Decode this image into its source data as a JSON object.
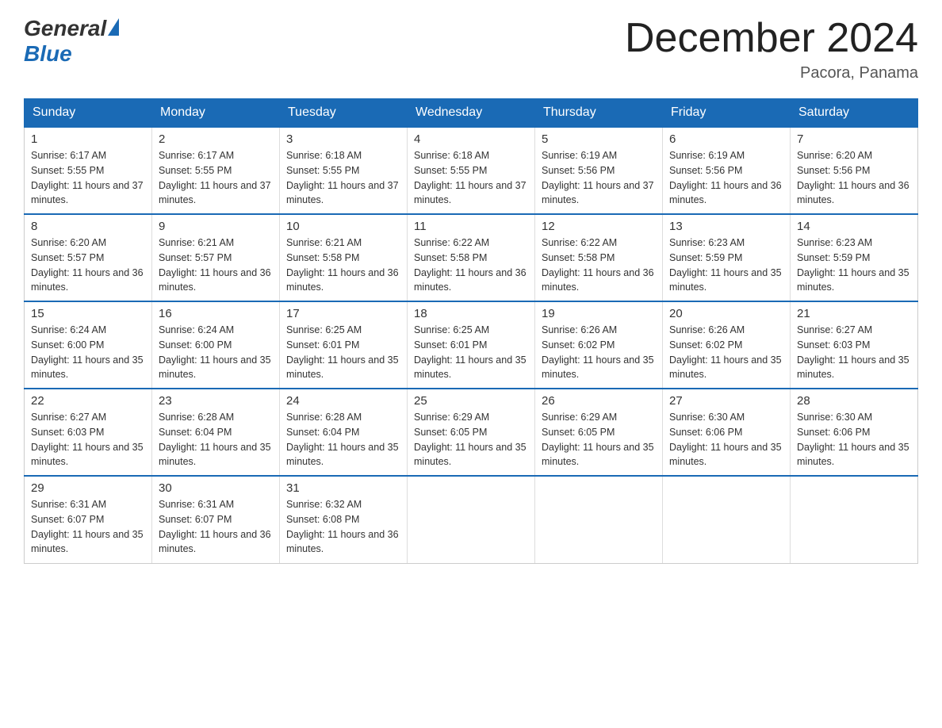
{
  "logo": {
    "text_general": "General",
    "text_blue": "Blue",
    "triangle_color": "#1a6ab5"
  },
  "header": {
    "month_year": "December 2024",
    "location": "Pacora, Panama"
  },
  "days_of_week": [
    "Sunday",
    "Monday",
    "Tuesday",
    "Wednesday",
    "Thursday",
    "Friday",
    "Saturday"
  ],
  "weeks": [
    [
      {
        "day": "1",
        "sunrise": "6:17 AM",
        "sunset": "5:55 PM",
        "daylight": "11 hours and 37 minutes."
      },
      {
        "day": "2",
        "sunrise": "6:17 AM",
        "sunset": "5:55 PM",
        "daylight": "11 hours and 37 minutes."
      },
      {
        "day": "3",
        "sunrise": "6:18 AM",
        "sunset": "5:55 PM",
        "daylight": "11 hours and 37 minutes."
      },
      {
        "day": "4",
        "sunrise": "6:18 AM",
        "sunset": "5:55 PM",
        "daylight": "11 hours and 37 minutes."
      },
      {
        "day": "5",
        "sunrise": "6:19 AM",
        "sunset": "5:56 PM",
        "daylight": "11 hours and 37 minutes."
      },
      {
        "day": "6",
        "sunrise": "6:19 AM",
        "sunset": "5:56 PM",
        "daylight": "11 hours and 36 minutes."
      },
      {
        "day": "7",
        "sunrise": "6:20 AM",
        "sunset": "5:56 PM",
        "daylight": "11 hours and 36 minutes."
      }
    ],
    [
      {
        "day": "8",
        "sunrise": "6:20 AM",
        "sunset": "5:57 PM",
        "daylight": "11 hours and 36 minutes."
      },
      {
        "day": "9",
        "sunrise": "6:21 AM",
        "sunset": "5:57 PM",
        "daylight": "11 hours and 36 minutes."
      },
      {
        "day": "10",
        "sunrise": "6:21 AM",
        "sunset": "5:58 PM",
        "daylight": "11 hours and 36 minutes."
      },
      {
        "day": "11",
        "sunrise": "6:22 AM",
        "sunset": "5:58 PM",
        "daylight": "11 hours and 36 minutes."
      },
      {
        "day": "12",
        "sunrise": "6:22 AM",
        "sunset": "5:58 PM",
        "daylight": "11 hours and 36 minutes."
      },
      {
        "day": "13",
        "sunrise": "6:23 AM",
        "sunset": "5:59 PM",
        "daylight": "11 hours and 35 minutes."
      },
      {
        "day": "14",
        "sunrise": "6:23 AM",
        "sunset": "5:59 PM",
        "daylight": "11 hours and 35 minutes."
      }
    ],
    [
      {
        "day": "15",
        "sunrise": "6:24 AM",
        "sunset": "6:00 PM",
        "daylight": "11 hours and 35 minutes."
      },
      {
        "day": "16",
        "sunrise": "6:24 AM",
        "sunset": "6:00 PM",
        "daylight": "11 hours and 35 minutes."
      },
      {
        "day": "17",
        "sunrise": "6:25 AM",
        "sunset": "6:01 PM",
        "daylight": "11 hours and 35 minutes."
      },
      {
        "day": "18",
        "sunrise": "6:25 AM",
        "sunset": "6:01 PM",
        "daylight": "11 hours and 35 minutes."
      },
      {
        "day": "19",
        "sunrise": "6:26 AM",
        "sunset": "6:02 PM",
        "daylight": "11 hours and 35 minutes."
      },
      {
        "day": "20",
        "sunrise": "6:26 AM",
        "sunset": "6:02 PM",
        "daylight": "11 hours and 35 minutes."
      },
      {
        "day": "21",
        "sunrise": "6:27 AM",
        "sunset": "6:03 PM",
        "daylight": "11 hours and 35 minutes."
      }
    ],
    [
      {
        "day": "22",
        "sunrise": "6:27 AM",
        "sunset": "6:03 PM",
        "daylight": "11 hours and 35 minutes."
      },
      {
        "day": "23",
        "sunrise": "6:28 AM",
        "sunset": "6:04 PM",
        "daylight": "11 hours and 35 minutes."
      },
      {
        "day": "24",
        "sunrise": "6:28 AM",
        "sunset": "6:04 PM",
        "daylight": "11 hours and 35 minutes."
      },
      {
        "day": "25",
        "sunrise": "6:29 AM",
        "sunset": "6:05 PM",
        "daylight": "11 hours and 35 minutes."
      },
      {
        "day": "26",
        "sunrise": "6:29 AM",
        "sunset": "6:05 PM",
        "daylight": "11 hours and 35 minutes."
      },
      {
        "day": "27",
        "sunrise": "6:30 AM",
        "sunset": "6:06 PM",
        "daylight": "11 hours and 35 minutes."
      },
      {
        "day": "28",
        "sunrise": "6:30 AM",
        "sunset": "6:06 PM",
        "daylight": "11 hours and 35 minutes."
      }
    ],
    [
      {
        "day": "29",
        "sunrise": "6:31 AM",
        "sunset": "6:07 PM",
        "daylight": "11 hours and 35 minutes."
      },
      {
        "day": "30",
        "sunrise": "6:31 AM",
        "sunset": "6:07 PM",
        "daylight": "11 hours and 36 minutes."
      },
      {
        "day": "31",
        "sunrise": "6:32 AM",
        "sunset": "6:08 PM",
        "daylight": "11 hours and 36 minutes."
      },
      null,
      null,
      null,
      null
    ]
  ]
}
